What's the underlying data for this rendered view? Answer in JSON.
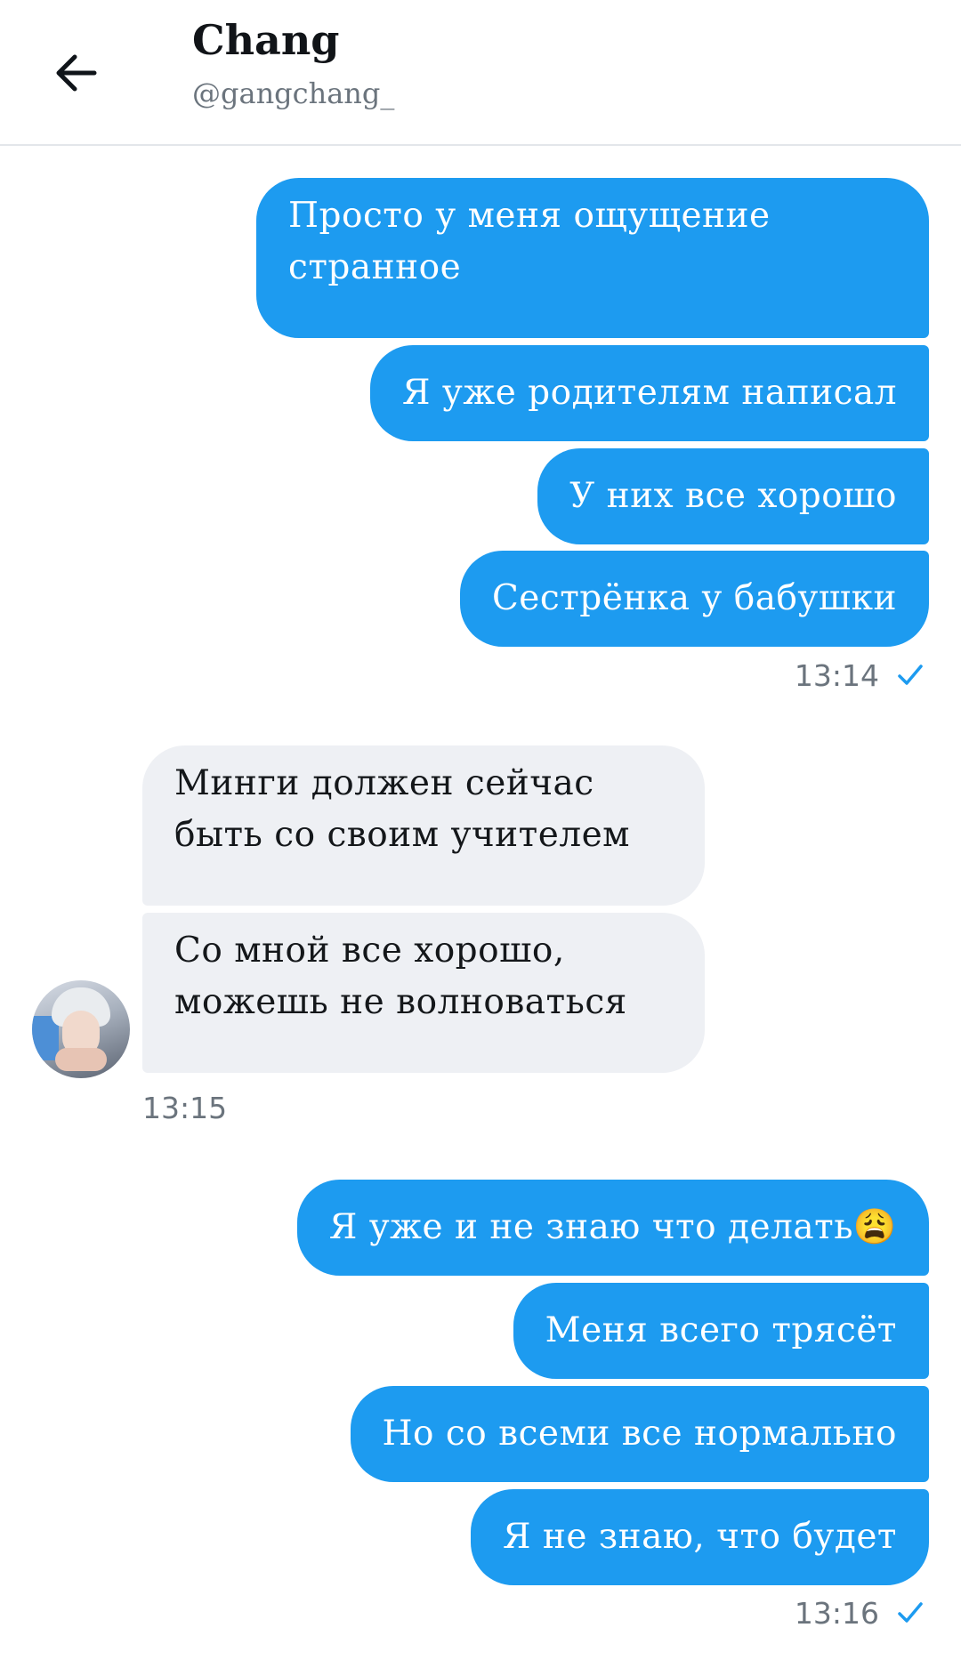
{
  "header": {
    "name": "Chang",
    "handle": "@gangchang_"
  },
  "icons": {
    "back": "arrow-left-icon",
    "read": "checkmark-icon"
  },
  "colors": {
    "outgoing_bubble": "#1d9bf0",
    "incoming_bubble": "#eef0f4",
    "checkmark": "#1d9bf0"
  },
  "messages": {
    "group1": {
      "items": [
        "Просто у меня ощущение странное",
        "Я уже родителям написал",
        "У них все хорошо",
        "Сестрёнка у бабушки"
      ],
      "time": "13:14"
    },
    "group2": {
      "items": [
        "Минги должен сейчас быть со своим учителем",
        "Со мной все хорошо, можешь не волноваться"
      ],
      "time": "13:15"
    },
    "group3": {
      "items": [
        "Я уже и не знаю что делать😩",
        "Меня всего трясёт",
        "Но со всеми все нормально",
        "Я не знаю, что будет"
      ],
      "time": "13:16"
    }
  }
}
